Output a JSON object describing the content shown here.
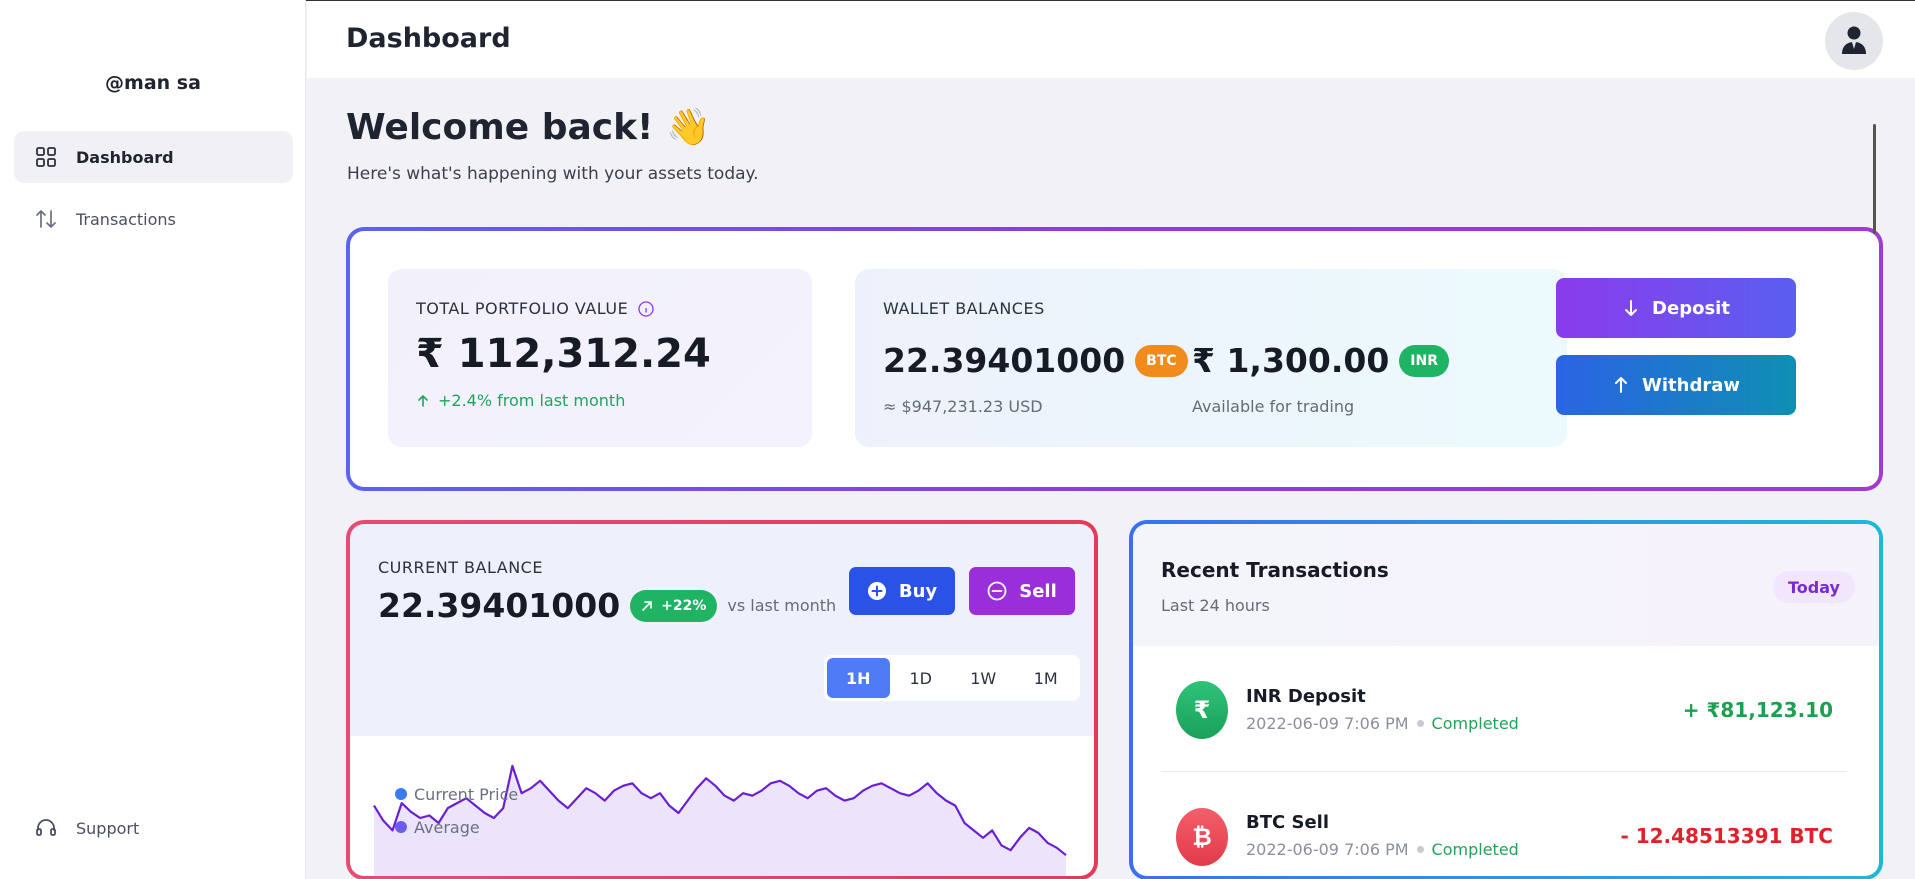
{
  "sidebar": {
    "brand": "@man sa",
    "items": [
      {
        "label": "Dashboard",
        "icon": "grid-icon",
        "active": true
      },
      {
        "label": "Transactions",
        "icon": "arrows-up-down-icon",
        "active": false
      }
    ],
    "support_label": "Support"
  },
  "header": {
    "title": "Dashboard",
    "avatar_icon": "user-icon"
  },
  "welcome": {
    "title": "Welcome back! 👋",
    "subtitle": "Here's what's happening with your assets today."
  },
  "portfolio": {
    "label": "TOTAL PORTFOLIO VALUE",
    "value": "₹ 112,312.24",
    "change": "+2.4% from last month"
  },
  "wallet": {
    "label": "WALLET BALANCES",
    "btc_value": "22.39401000",
    "btc_badge": "BTC",
    "btc_usd": "≈ $947,231.23 USD",
    "inr_value": "₹ 1,300.00",
    "inr_badge": "INR",
    "inr_note": "Available for trading"
  },
  "actions": {
    "deposit_label": "Deposit",
    "withdraw_label": "Withdraw"
  },
  "balance": {
    "label": "CURRENT BALANCE",
    "value": "22.39401000",
    "change_badge": "+22%",
    "change_note": "vs last month",
    "buy_label": "Buy",
    "sell_label": "Sell",
    "ranges": [
      "1H",
      "1D",
      "1W",
      "1M"
    ],
    "active_range": "1H"
  },
  "chart_data": {
    "type": "line",
    "title": "",
    "series": [
      {
        "name": "Current Price",
        "color": "#6a1fd6",
        "values": [
          60,
          48,
          40,
          62,
          55,
          50,
          52,
          46,
          58,
          62,
          66,
          60,
          54,
          50,
          58,
          92,
          70,
          74,
          80,
          72,
          64,
          58,
          66,
          74,
          70,
          64,
          72,
          76,
          78,
          70,
          66,
          70,
          60,
          54,
          64,
          74,
          82,
          76,
          68,
          64,
          70,
          68,
          72,
          78,
          80,
          76,
          70,
          66,
          72,
          74,
          68,
          64,
          66,
          72,
          76,
          78,
          74,
          70,
          68,
          72,
          78,
          70,
          64,
          60,
          46,
          40,
          34,
          40,
          28,
          24,
          34,
          42,
          38,
          30,
          26,
          20
        ]
      },
      {
        "name": "Average",
        "color": "#5b5ef0",
        "values": []
      }
    ],
    "colors": {
      "current": "#3b7bf0",
      "average": "#6b5cf0"
    }
  },
  "transactions": {
    "title": "Recent Transactions",
    "subtitle": "Last 24 hours",
    "badge": "Today",
    "items": [
      {
        "title": "INR Deposit",
        "datetime": "2022-06-09 7:06 PM",
        "status": "Completed",
        "amount": "+ ₹81,123.10",
        "icon": "rupee-icon",
        "color": "#22a35a"
      },
      {
        "title": "BTC Sell",
        "datetime": "2022-06-09 7:06 PM",
        "status": "Completed",
        "amount": "- 12.48513391 BTC",
        "icon": "bitcoin-icon",
        "color": "#e0202a"
      }
    ]
  },
  "colors": {
    "accent_purple": "#8a3cec",
    "accent_blue": "#2a52e6",
    "success": "#22a35a",
    "danger": "#e0202a",
    "btc_orange": "#f08b1c"
  }
}
